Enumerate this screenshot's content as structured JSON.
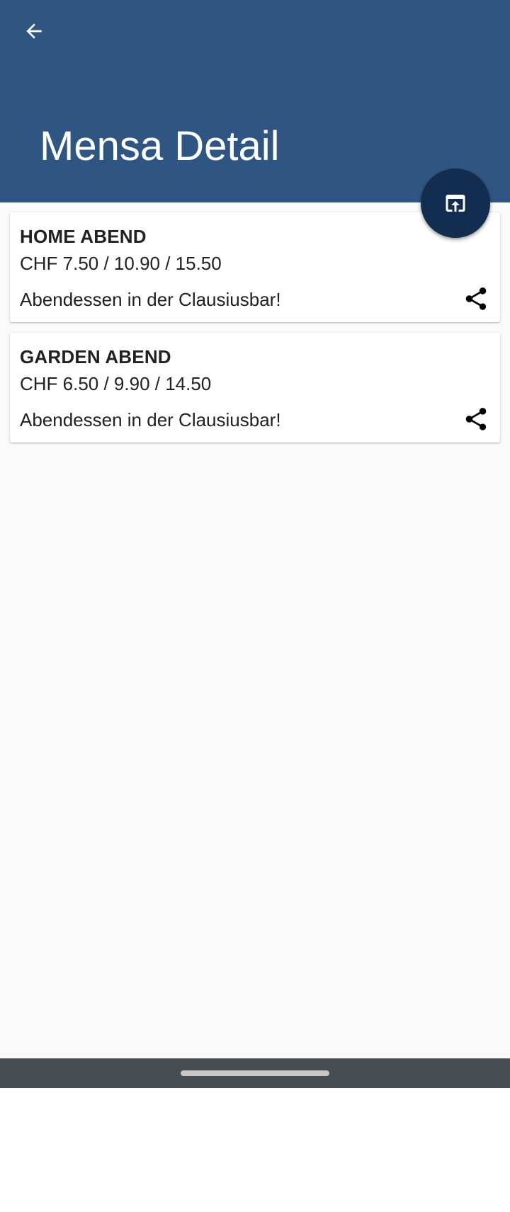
{
  "header": {
    "title": "Mensa Detail",
    "back_icon": "arrow-back-icon",
    "background_color": "#2f5682"
  },
  "fab": {
    "icon": "open-in-browser-icon",
    "color": "#132d51"
  },
  "menu_items": [
    {
      "name": "HOME ABEND",
      "price": "CHF 7.50 / 10.90 / 15.50",
      "description": "Abendessen in der Clausiusbar!",
      "action_icon": "share-icon"
    },
    {
      "name": "GARDEN ABEND",
      "price": "CHF 6.50 / 9.90 / 14.50",
      "description": "Abendessen in der Clausiusbar!",
      "action_icon": "share-icon"
    }
  ],
  "system_nav": {
    "background_color": "#474c50"
  }
}
